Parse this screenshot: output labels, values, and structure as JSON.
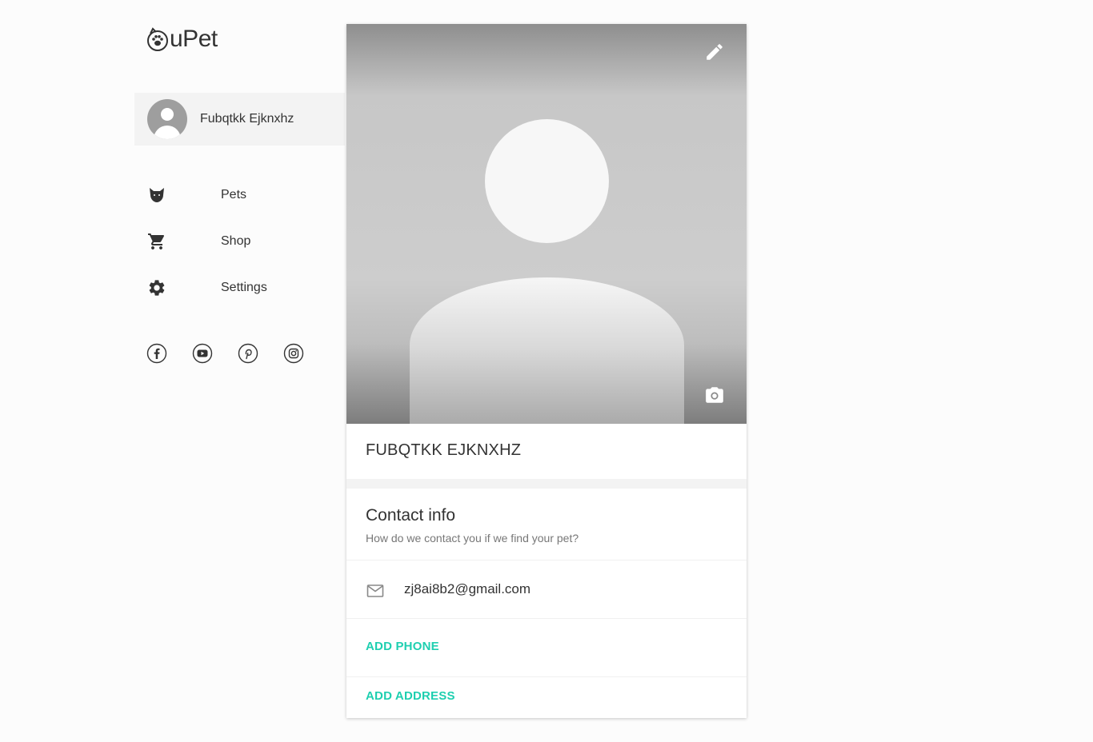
{
  "brand": {
    "logo_text": "uPet",
    "accent_color": "#1ecfb0"
  },
  "user": {
    "name": "Fubqtkk Ejknxhz"
  },
  "nav": {
    "items": [
      {
        "label": "Pets",
        "icon": "dog-head-icon"
      },
      {
        "label": "Shop",
        "icon": "cart-icon"
      },
      {
        "label": "Settings",
        "icon": "gear-icon"
      }
    ]
  },
  "social": [
    "facebook-icon",
    "youtube-icon",
    "pinterest-icon",
    "instagram-icon"
  ],
  "profile": {
    "name_heading": "FUBQTKK EJKNXHZ",
    "contact_title": "Contact info",
    "contact_subtitle": "How do we contact you if we find your pet?",
    "email": "zj8ai8b2@gmail.com",
    "add_phone_label": "ADD PHONE",
    "add_address_label": "ADD ADDRESS"
  }
}
